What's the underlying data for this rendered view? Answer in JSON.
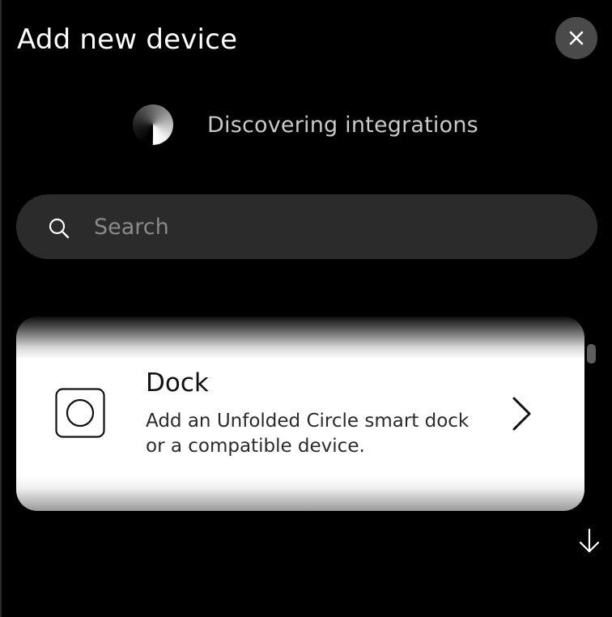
{
  "header": {
    "title": "Add new device",
    "close_icon": "close-icon"
  },
  "discovery": {
    "status_text": "Discovering integrations",
    "spinner_icon": "loading-spinner-icon"
  },
  "search": {
    "placeholder": "Search",
    "value": "",
    "icon": "search-icon"
  },
  "integrations": [
    {
      "title": "Dock",
      "description": "Add an Unfolded Circle smart dock or a compatible device.",
      "icon": "dock-icon",
      "action_icon": "chevron-right-icon"
    }
  ],
  "scroll": {
    "down_icon": "arrow-down-icon"
  },
  "colors": {
    "background": "#000000",
    "close_button_bg": "#4a4a4a",
    "search_bg": "#2b2b2b",
    "card_bg": "#ffffff",
    "status_text": "#c9c9c9"
  }
}
